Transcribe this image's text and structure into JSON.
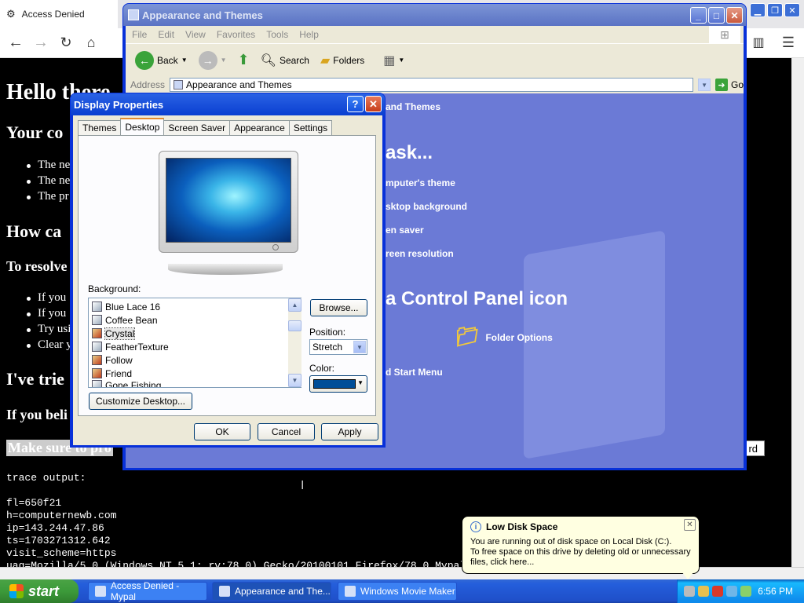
{
  "browser": {
    "tab_title": "Access Denied",
    "content": {
      "h1": "Hello there",
      "h2_1": "Your co",
      "bullets_1": [
        "The ne",
        "The ne",
        "The pr"
      ],
      "h2_2": "How ca",
      "h3_1": "To resolve",
      "bullets_2": [
        "If you",
        "If you",
        "Try usi",
        "Clear y"
      ],
      "h2_3": "I've trie",
      "h3_2": "If you beli",
      "highlight": "Make sure to pro",
      "trace_label": "trace output:",
      "trace_lines": [
        "fl=650f21",
        "h=computernewb.com",
        "ip=143.244.47.86",
        "ts=1703271312.642",
        "visit_scheme=https",
        "uag=Mozilla/5.0 (Windows NT 5.1; rv:78.0) Gecko/20100101 Firefox/78.0 Mypal"
      ],
      "button_fragment": "rd"
    }
  },
  "explorer": {
    "title": "Appearance and Themes",
    "menu": [
      "File",
      "Edit",
      "View",
      "Favorites",
      "Tools",
      "Help"
    ],
    "toolbar": {
      "back": "Back",
      "search": "Search",
      "folders": "Folders"
    },
    "address_label": "Address",
    "address_value": "Appearance and Themes",
    "go_label": "Go",
    "body": {
      "crumb": "and Themes",
      "pick_task": "ask...",
      "tasks": [
        "mputer's theme",
        "sktop background",
        "en saver",
        "reen resolution"
      ],
      "pick_icon": "a Control Panel icon",
      "folder_options": "Folder Options",
      "start_menu": "d Start Menu"
    }
  },
  "dialog": {
    "title": "Display Properties",
    "help_btn": "?",
    "close_btn": "✕",
    "tabs": [
      "Themes",
      "Desktop",
      "Screen Saver",
      "Appearance",
      "Settings"
    ],
    "active_tab": "Desktop",
    "background_label": "Background:",
    "backgrounds": [
      {
        "name": "Blue Lace 16",
        "kind": "pattern"
      },
      {
        "name": "Coffee Bean",
        "kind": "pattern"
      },
      {
        "name": "Crystal",
        "kind": "image",
        "selected": true
      },
      {
        "name": "FeatherTexture",
        "kind": "pattern"
      },
      {
        "name": "Follow",
        "kind": "image"
      },
      {
        "name": "Friend",
        "kind": "image"
      },
      {
        "name": "Gone Fishing",
        "kind": "pattern"
      }
    ],
    "browse_label": "Browse...",
    "position_label": "Position:",
    "position_value": "Stretch",
    "color_label": "Color:",
    "color_value": "#004e98",
    "customize_label": "Customize Desktop...",
    "ok_label": "OK",
    "cancel_label": "Cancel",
    "apply_label": "Apply"
  },
  "taskbar": {
    "start_label": "start",
    "tasks": [
      "Access Denied - Mypal",
      "Appearance and The...",
      "Windows Movie Maker"
    ],
    "clock": "6:56 PM"
  },
  "balloon": {
    "title": "Low Disk Space",
    "line1": "You are running out of disk space on Local Disk (C:).",
    "line2": "To free space on this drive by deleting old or unnecessary files, click here..."
  }
}
